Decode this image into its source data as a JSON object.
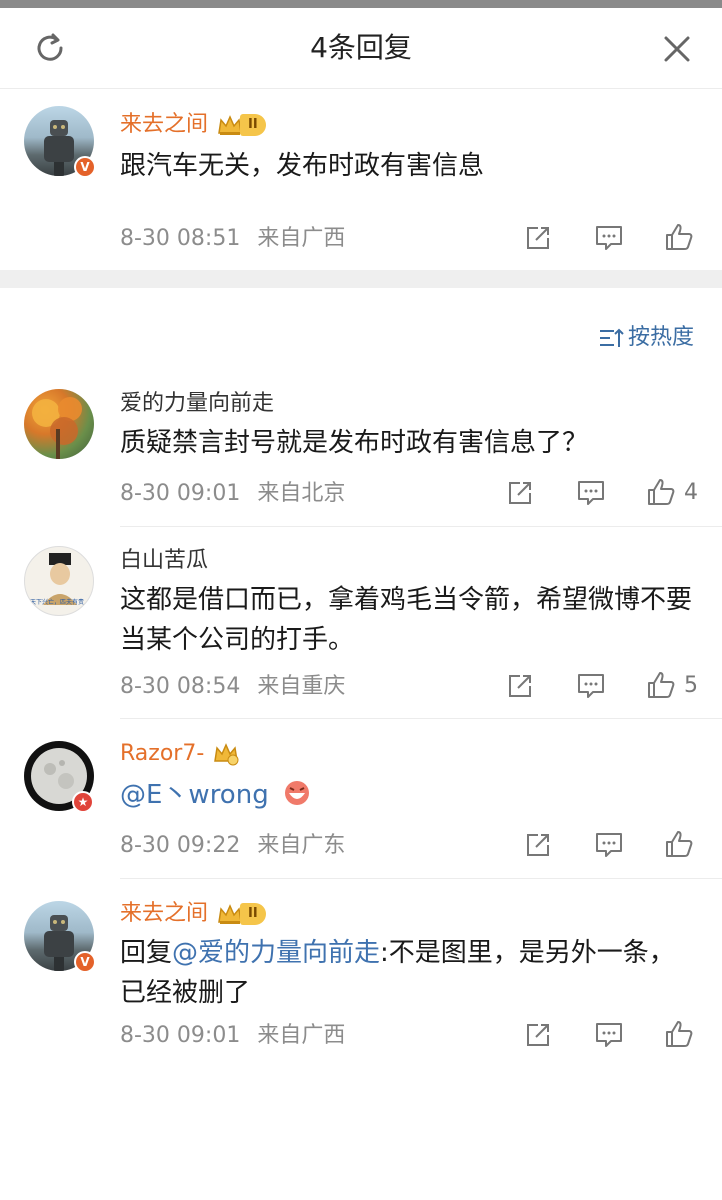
{
  "header": {
    "title": "4条回复",
    "refresh_icon": "refresh-icon",
    "close_icon": "close-icon"
  },
  "sort": {
    "label": "按热度",
    "icon": "sort-icon"
  },
  "colors": {
    "accent_orange": "#e4702a",
    "link_blue": "#3f72af",
    "meta_gray": "#8c8c8c",
    "verified_badge": "#e4622a"
  },
  "main_comment": {
    "user": "来去之间",
    "level": "II",
    "text": "跟汽车无关，发布时政有害信息",
    "date": "8-30 08:51",
    "location": "来自广西"
  },
  "replies": [
    {
      "user": "爱的力量向前走",
      "text": "质疑禁言封号就是发布时政有害信息了？",
      "date": "8-30 09:01",
      "location": "来自北京",
      "likes": "4"
    },
    {
      "user": "白山苦瓜",
      "avatar_caption": "天下兴亡，匹夫有责…",
      "text": "这都是借口而已，拿着鸡毛当令箭，希望微博不要当某个公司的打手。",
      "date": "8-30 08:54",
      "location": "来自重庆",
      "likes": "5"
    },
    {
      "user": "Razor7-",
      "mention": "@E丶wrong",
      "date": "8-30 09:22",
      "location": "来自广东"
    },
    {
      "user": "来去之间",
      "level": "II",
      "reply_prefix": "回复",
      "reply_mention": "@爱的力量向前走",
      "reply_text": ":不是图里，是另外一条，已经被删了",
      "date": "8-30 09:01",
      "location": "来自广西"
    }
  ]
}
